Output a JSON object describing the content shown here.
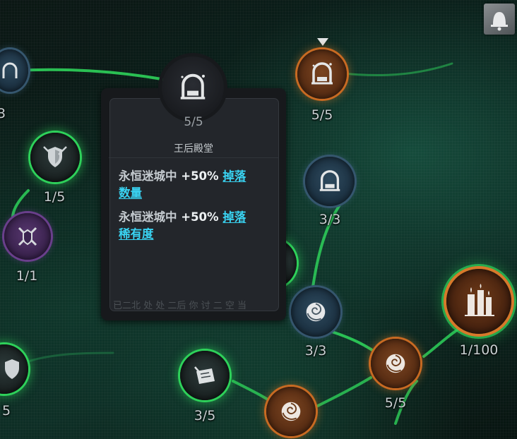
{
  "tooltip": {
    "count": "5/5",
    "name": "王后殿堂",
    "effects": [
      {
        "prefix": "永恒迷城中",
        "value": "+50%",
        "link_line1": "掉落",
        "link_line2": "数量"
      },
      {
        "prefix": "永恒迷城中",
        "value": "+50%",
        "link_line1": "掉落",
        "link_line2": "稀有度"
      }
    ],
    "cut_text": "已二北 处 处 二后 你 讨 二 空 当"
  },
  "nodes": [
    {
      "count": "3",
      "icon": "archway-icon",
      "style": "blue"
    },
    {
      "count": "1/5",
      "icon": "shield-swords-icon",
      "style": "green"
    },
    {
      "count": "1/1",
      "icon": "crossed-swords-icon",
      "style": "purple"
    },
    {
      "count": "5/5",
      "icon": "archway-icon",
      "style": "orange"
    },
    {
      "count": "3/3",
      "icon": "archway-icon",
      "style": "blue"
    },
    {
      "count": "3/3",
      "icon": "rose-icon",
      "style": "blue"
    },
    {
      "count": "1/100",
      "icon": "candles-icon",
      "style": "big-orange"
    },
    {
      "count": "5/5",
      "icon": "rose-icon",
      "style": "orange"
    },
    {
      "count": "3/5",
      "icon": "scroll-quill-icon",
      "style": "green"
    },
    {
      "count": "5",
      "icon": "shield-icon",
      "style": "green"
    },
    {
      "count": "",
      "icon": "rose-icon",
      "style": "orange"
    },
    {
      "count": "",
      "icon": "node-icon",
      "style": "green"
    }
  ],
  "colors": {
    "link_cyan": "#39d3f2",
    "active_green": "#2ed15a",
    "orange_rim": "#c86a22"
  }
}
